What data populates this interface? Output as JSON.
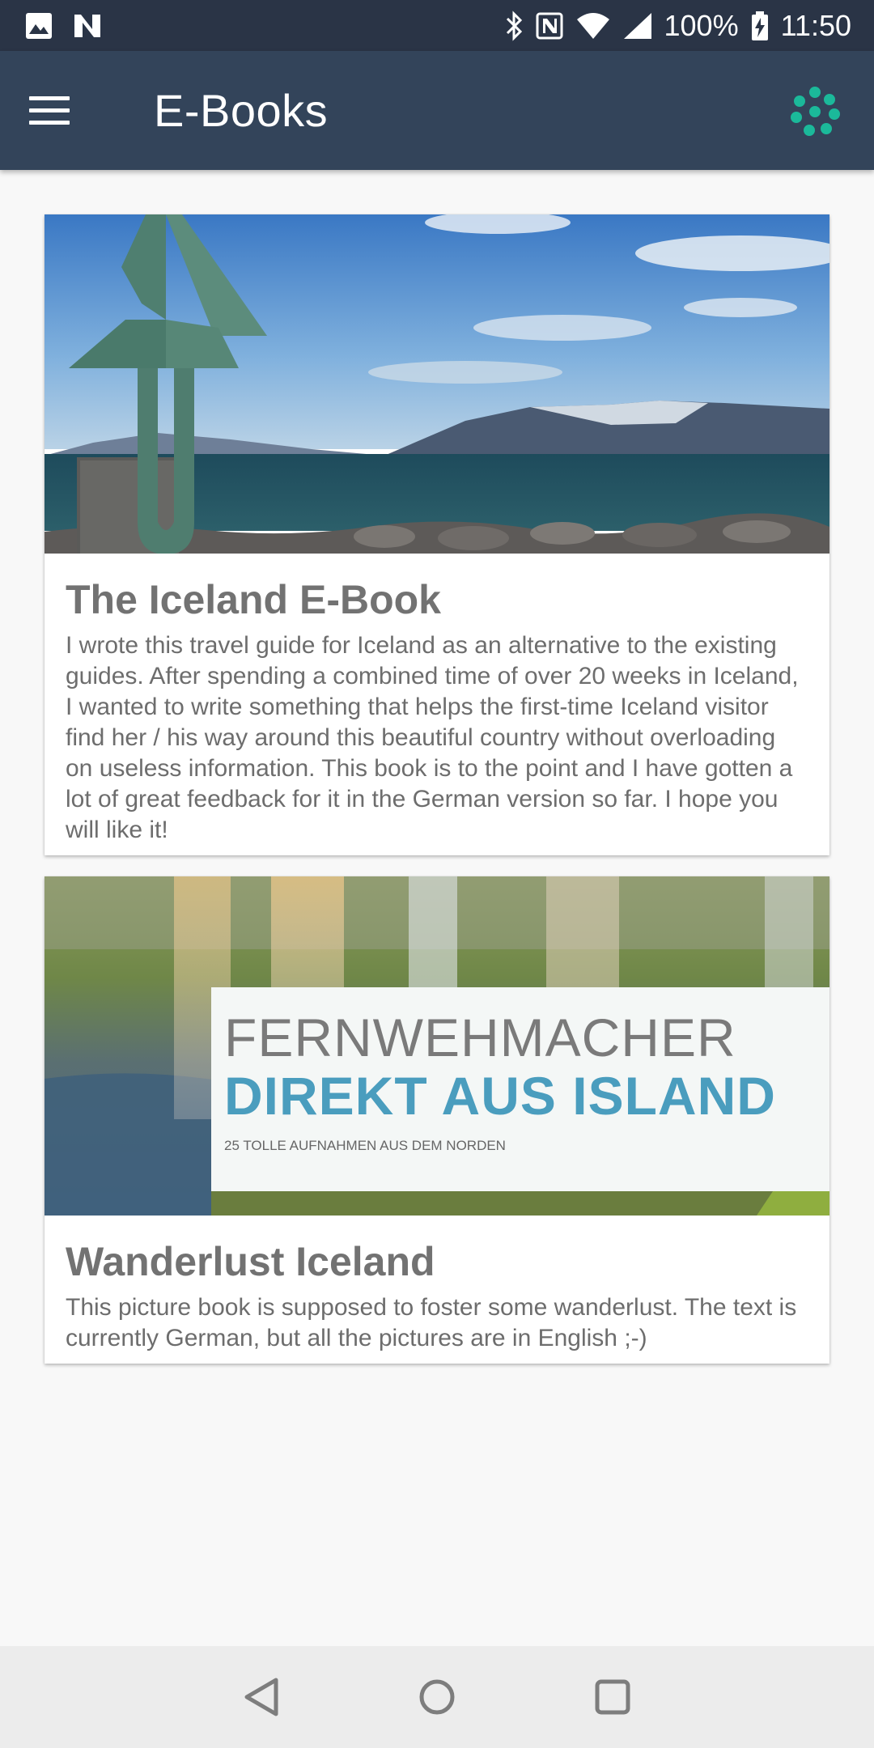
{
  "status_bar": {
    "battery": "100%",
    "time": "11:50",
    "left_icons": [
      "image-icon",
      "n-app-icon"
    ],
    "right_icons": [
      "bluetooth-icon",
      "nfc-icon",
      "wifi-icon",
      "signal-icon",
      "battery-charging-icon"
    ]
  },
  "app_bar": {
    "title": "E-Books",
    "menu_icon": "hamburger-menu-icon",
    "action_icon": "dots-circle-icon",
    "accent_color": "#1bb99a",
    "background": "#33445a"
  },
  "books": [
    {
      "title": "The Iceland E-Book",
      "description": "I wrote this travel guide for Iceland as an alternative to the existing guides. After spending a combined time of over 20 weeks in Iceland, I wanted to write something that helps the first-time Iceland visitor find her / his way around this beautiful country without overloading on useless information. This book is to the point and I have gotten a lot of great feedback for it in the German version so far. I hope you will like it!"
    },
    {
      "title": "Wanderlust Iceland",
      "description": "This picture book is supposed to foster some wanderlust. The text is currently German, but all the pictures are in English ;-)",
      "cover": {
        "line1": "FERNWEHMACHER",
        "line2": "DIREKT AUS ISLAND",
        "line3": "25 TOLLE AUFNAHMEN AUS DEM NORDEN"
      }
    }
  ],
  "nav_bar": {
    "icons": [
      "back-icon",
      "home-icon",
      "recents-icon"
    ]
  }
}
